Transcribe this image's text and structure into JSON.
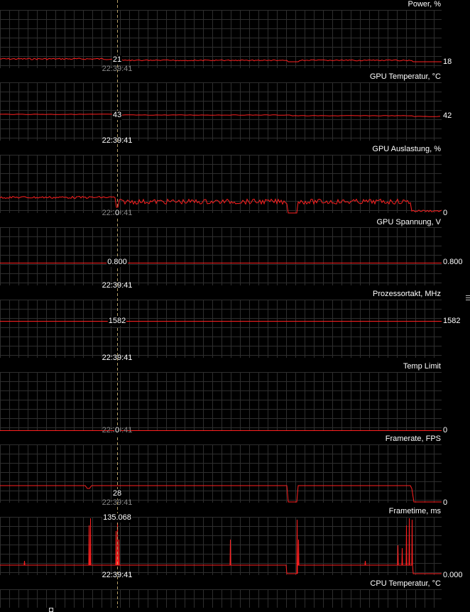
{
  "cursor": {
    "time": "22:39:41"
  },
  "panels": [
    {
      "title": "Power, %",
      "cursor_value": "21",
      "right_value": "18",
      "time_dim": true
    },
    {
      "title": "GPU Temperatur, °C",
      "cursor_value": "43",
      "right_value": "42",
      "time_dim": false
    },
    {
      "title": "GPU Auslastung, %",
      "cursor_value": "0",
      "right_value": "0",
      "time_dim": true
    },
    {
      "title": "GPU Spannung, V",
      "cursor_value": "0.800",
      "right_value": "0.800",
      "time_dim": false
    },
    {
      "title": "Prozessortakt, MHz",
      "cursor_value": "1582",
      "right_value": "1582",
      "time_dim": false
    },
    {
      "title": "Temp Limit",
      "cursor_value": "0",
      "right_value": "0",
      "time_dim": true
    },
    {
      "title": "Framerate, FPS",
      "cursor_value": "28",
      "right_value": "0",
      "time_dim": true
    },
    {
      "title": "Frametime, ms",
      "cursor_value": "135.068",
      "right_value": "0.000",
      "time_dim": false
    },
    {
      "title": "CPU Temperatur, °C",
      "cursor_value": "",
      "right_value": "",
      "time_dim": false
    }
  ],
  "colors": {
    "trace": "#ff2020",
    "grid": "#2e2e2e",
    "background": "#000000",
    "cursor_line": "#c8b070"
  }
}
